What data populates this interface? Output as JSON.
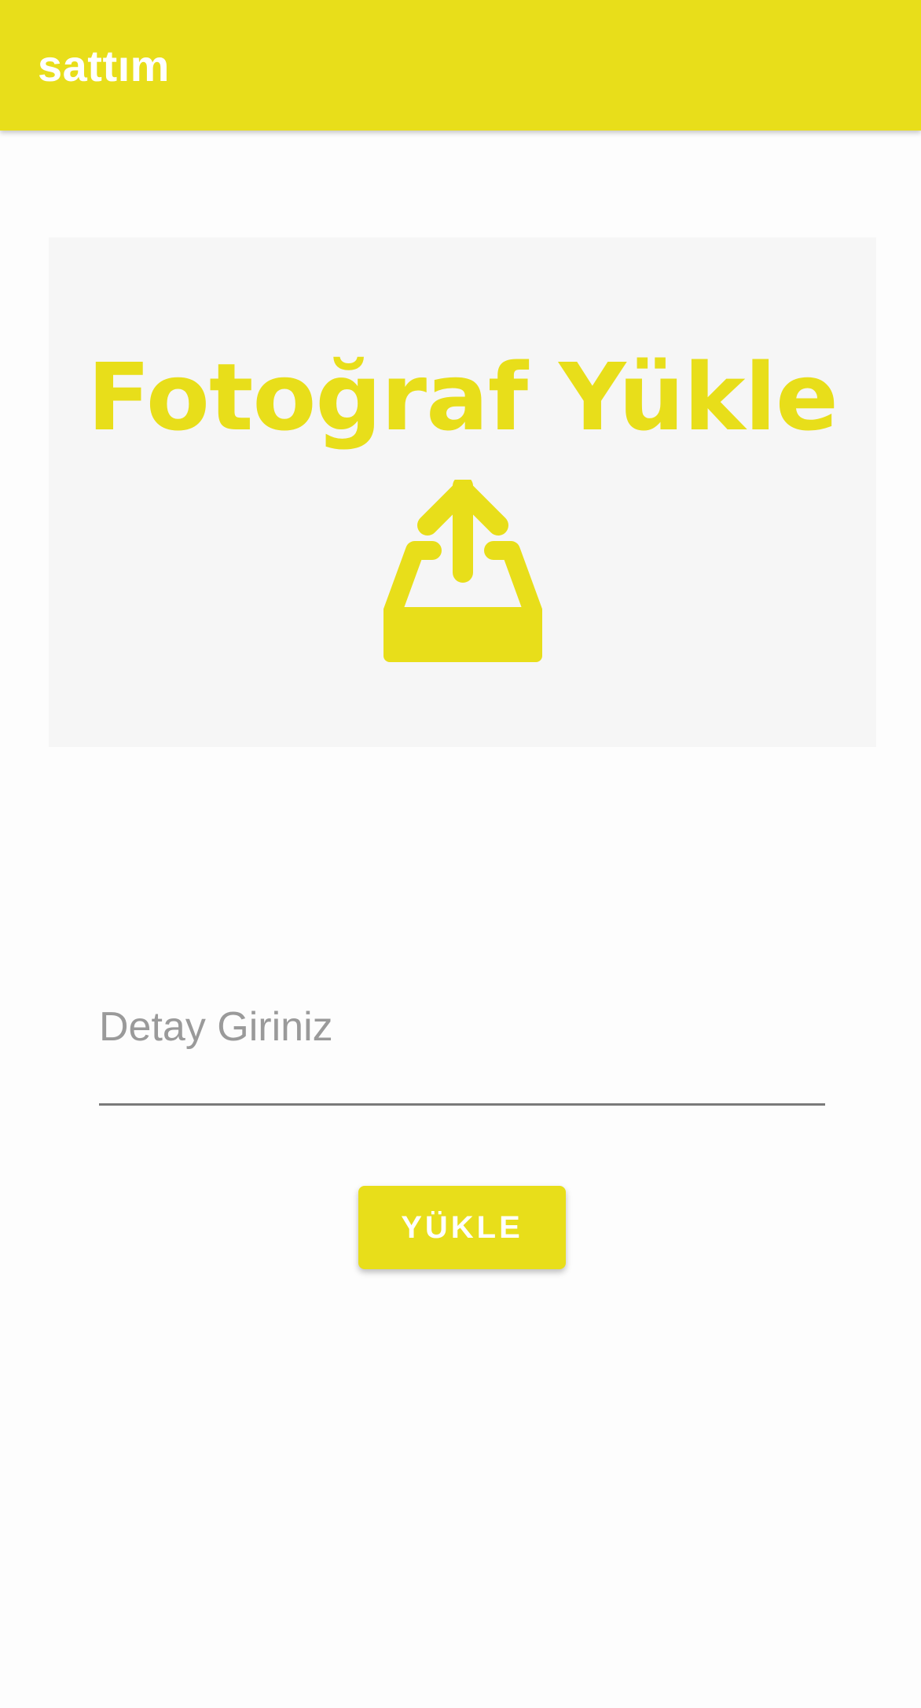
{
  "app_bar": {
    "title": "sattım"
  },
  "upload_panel": {
    "heading": "Fotoğraf Yükle",
    "icon": "upload-tray-icon"
  },
  "detail_field": {
    "placeholder": "Detay Giriniz",
    "value": ""
  },
  "actions": {
    "upload_label": "YÜKLE"
  },
  "colors": {
    "accent": "#e8de1a",
    "panel_background": "#f6f6f6",
    "page_background": "#fdfdfd",
    "placeholder_text": "#9a9a9a",
    "underline": "#7a7a7a"
  }
}
